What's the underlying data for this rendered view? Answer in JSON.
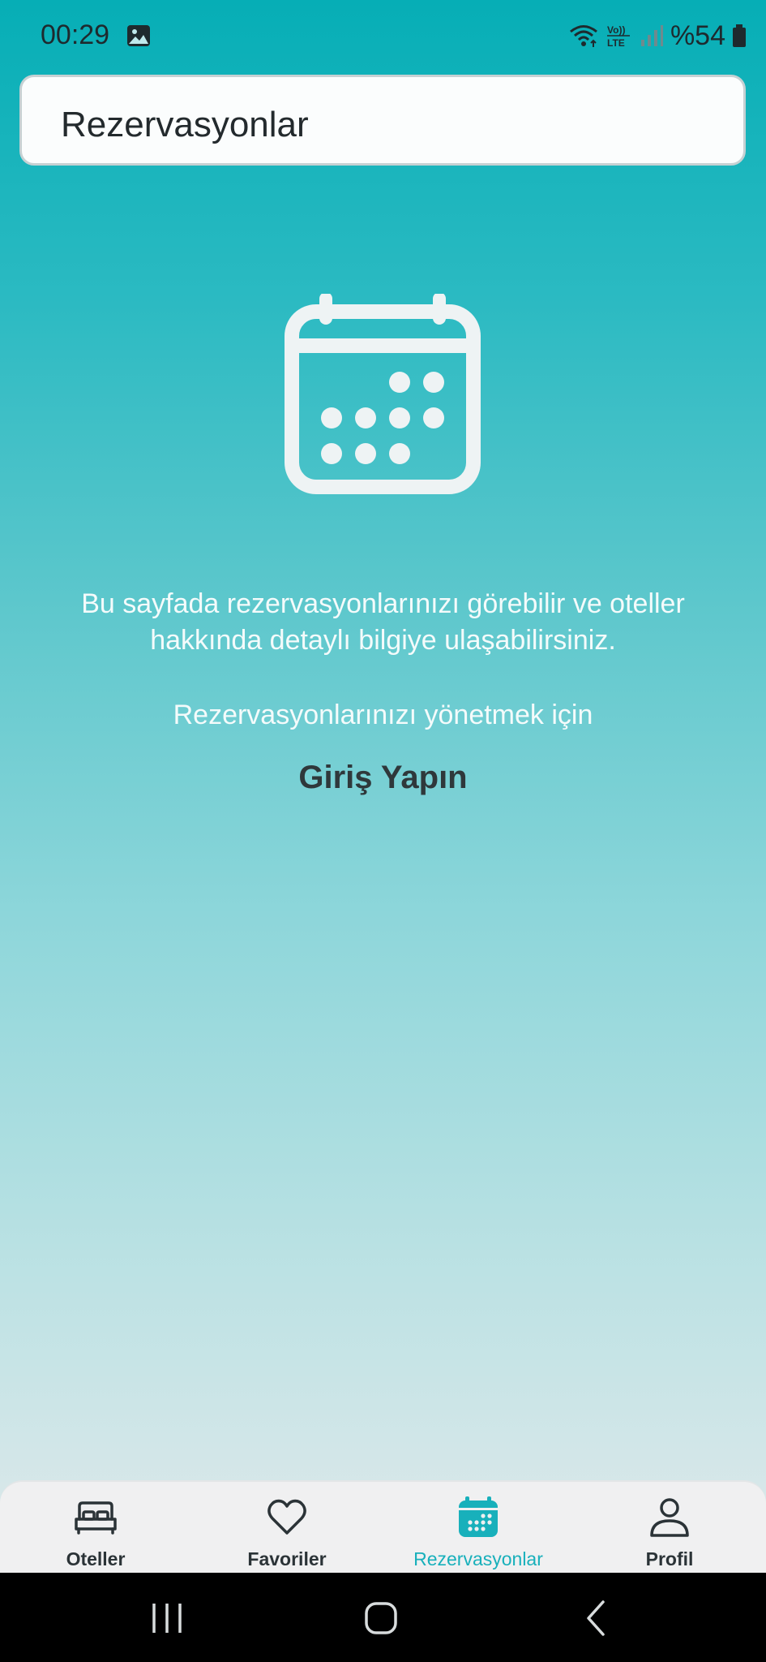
{
  "status_bar": {
    "time": "00:29",
    "battery": "%54",
    "icons": [
      "image-icon",
      "wifi-icon",
      "volte-icon",
      "signal-icon",
      "battery-icon"
    ]
  },
  "header": {
    "title": "Rezervasyonlar"
  },
  "main": {
    "icon": "calendar-icon",
    "description": "Bu sayfada rezervasyonlarınızı görebilir ve oteller hakkında detaylı bilgiye ulaşabilirsiniz.",
    "manage_text": "Rezervasyonlarınızı yönetmek için",
    "login_label": "Giriş Yapın"
  },
  "tabs": [
    {
      "label": "Oteller",
      "icon": "bed-icon",
      "active": false
    },
    {
      "label": "Favoriler",
      "icon": "heart-icon",
      "active": false
    },
    {
      "label": "Rezervasyonlar",
      "icon": "calendar-icon",
      "active": true
    },
    {
      "label": "Profil",
      "icon": "person-icon",
      "active": false
    }
  ],
  "colors": {
    "accent": "#18b0bb",
    "gradient_top": "#06aeb6",
    "gradient_bottom": "#e4ecee",
    "tabbar_bg": "#f0f0f1"
  },
  "system_nav": [
    "recents-icon",
    "home-icon",
    "back-icon"
  ]
}
